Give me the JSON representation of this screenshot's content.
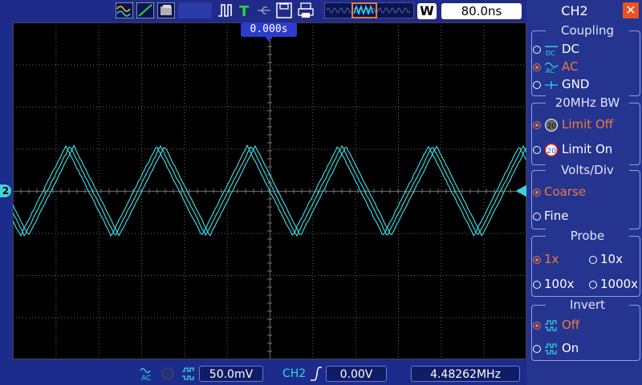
{
  "top_bar": {
    "timebase": "80.0ns",
    "timebase_icon_label": "W",
    "trigger_position": "0.000s"
  },
  "bottom_bar": {
    "volts_div": "50.0mV",
    "trigger_source": "CH2",
    "trigger_level": "0.00V",
    "frequency": "4.48262MHz"
  },
  "channel_marker": "2",
  "menu": {
    "title": "CH2",
    "coupling": {
      "title": "Coupling",
      "options": [
        {
          "label": "DC",
          "icon": "dc-coupling-icon",
          "selected": false
        },
        {
          "label": "AC",
          "icon": "ac-coupling-icon",
          "selected": true
        },
        {
          "label": "GND",
          "icon": "gnd-coupling-icon",
          "selected": false
        }
      ]
    },
    "bandwidth": {
      "title": "20MHz BW",
      "options": [
        {
          "label": "Limit Off",
          "icon_text": "20",
          "selected": true
        },
        {
          "label": "Limit On",
          "icon_text": "20",
          "selected": false
        }
      ]
    },
    "volts_div": {
      "title": "Volts/Div",
      "options": [
        {
          "label": "Coarse",
          "selected": true
        },
        {
          "label": "Fine",
          "selected": false
        }
      ]
    },
    "probe": {
      "title": "Probe",
      "options": [
        {
          "label": "1x",
          "selected": true
        },
        {
          "label": "10x",
          "selected": false
        },
        {
          "label": "100x",
          "selected": false
        },
        {
          "label": "1000x",
          "selected": false
        }
      ]
    },
    "invert": {
      "title": "Invert",
      "options": [
        {
          "label": "Off",
          "selected": true
        },
        {
          "label": "On",
          "selected": false
        }
      ]
    }
  },
  "colors": {
    "trace": "#3ad4dc",
    "selected": "#f07a3c",
    "panel_bg": "#24348f",
    "screen_bg": "#000000"
  }
}
